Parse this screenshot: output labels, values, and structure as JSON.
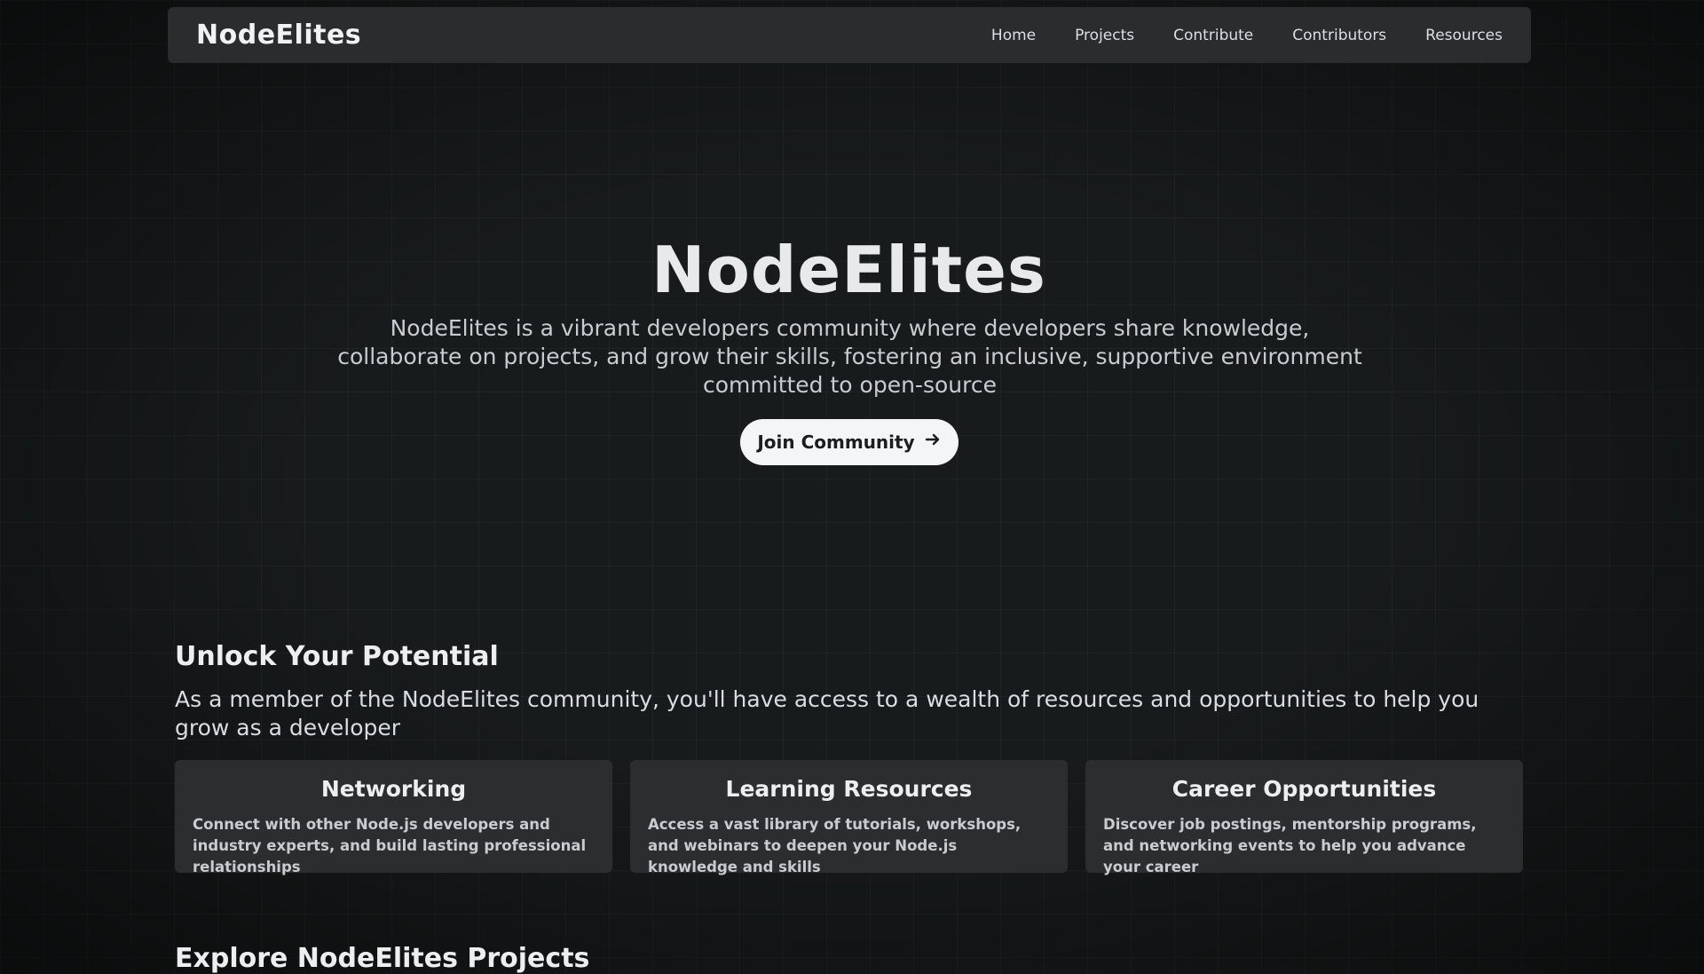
{
  "navbar": {
    "logo": "NodeElites",
    "links": [
      "Home",
      "Projects",
      "Contribute",
      "Contributors",
      "Resources"
    ]
  },
  "hero": {
    "title": "NodeElites",
    "description": "NodeElites is a vibrant developers community where developers share knowledge, collaborate on projects, and grow their skills, fostering an inclusive, supportive environment committed to open-source",
    "cta_label": "Join Community",
    "cta_icon": "arrow-right-icon"
  },
  "potential": {
    "title": "Unlock Your Potential",
    "description": "As a member of the NodeElites community, you'll have access to a wealth of resources and opportunities to help you grow as a developer",
    "cards": [
      {
        "title": "Networking",
        "text": "Connect with other Node.js developers and industry experts, and build lasting professional relationships"
      },
      {
        "title": "Learning Resources",
        "text": "Access a vast library of tutorials, workshops, and webinars to deepen your Node.js knowledge and skills"
      },
      {
        "title": "Career Opportunities",
        "text": "Discover job postings, mentorship programs, and networking events to help you advance your career"
      }
    ]
  },
  "projects": {
    "title": "Explore NodeElites Projects"
  }
}
